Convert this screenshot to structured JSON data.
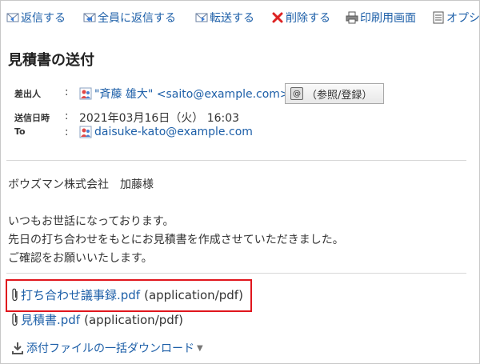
{
  "toolbar": {
    "reply": {
      "label": "返信する",
      "icon": "reply-icon"
    },
    "reply_all": {
      "label": "全員に返信する",
      "icon": "reply-all-icon"
    },
    "forward": {
      "label": "転送する",
      "icon": "forward-icon"
    },
    "delete": {
      "label": "削除する",
      "icon": "delete-icon"
    },
    "print": {
      "label": "印刷用画面",
      "icon": "print-icon"
    },
    "options": {
      "label": "オプシ",
      "icon": "options-icon"
    }
  },
  "message": {
    "subject": "見積書の送付",
    "sender_label": "差出人",
    "sender_value": "\"斉藤 雄大\" <saito@example.com>",
    "address_book_button": "（参照/登録）",
    "date_label": "送信日時",
    "date_value": "2021年03月16日（火） 16:03",
    "to_label": "To",
    "to_value": "daisuke-kato@example.com",
    "colon": ":"
  },
  "body": {
    "lines": [
      "ボウズマン株式会社　加藤様",
      "",
      "いつもお世話になっております。",
      "先日の打ち合わせをもとにお見積書を作成させていただきました。",
      "ご確認をお願いいたします。"
    ]
  },
  "attachments": [
    {
      "name": "打ち合わせ議事録.pdf",
      "mime": "(application/pdf)"
    },
    {
      "name": "見積書.pdf",
      "mime": "(application/pdf)"
    }
  ],
  "download_all": "添付ファイルの一括ダウンロード",
  "colors": {
    "link": "#1d5fa8",
    "delete": "#d22",
    "highlight": "#e0161d"
  }
}
